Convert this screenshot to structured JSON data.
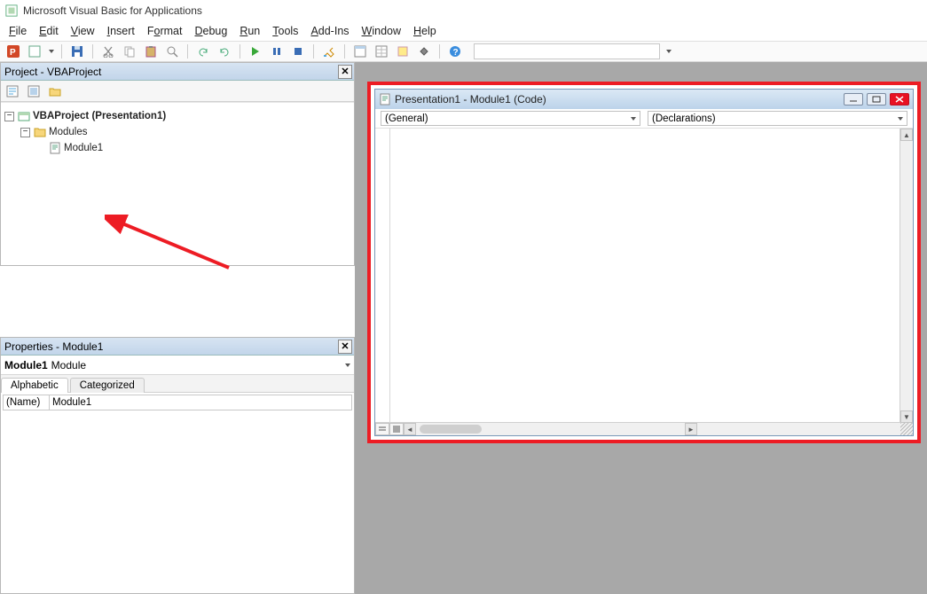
{
  "app": {
    "title": "Microsoft Visual Basic for Applications"
  },
  "menus": {
    "file": "File",
    "edit": "Edit",
    "view": "View",
    "insert": "Insert",
    "format": "Format",
    "debug": "Debug",
    "run": "Run",
    "tools": "Tools",
    "addins": "Add-Ins",
    "window": "Window",
    "help": "Help"
  },
  "project_panel": {
    "title": "Project - VBAProject",
    "root": "VBAProject (Presentation1)",
    "folder": "Modules",
    "module": "Module1"
  },
  "properties_panel": {
    "title": "Properties - Module1",
    "object_name": "Module1",
    "object_type": "Module",
    "tab_alpha": "Alphabetic",
    "tab_cat": "Categorized",
    "rows": [
      {
        "k": "(Name)",
        "v": "Module1"
      }
    ]
  },
  "code_window": {
    "title": "Presentation1 - Module1 (Code)",
    "left_dd": "(General)",
    "right_dd": "(Declarations)"
  }
}
